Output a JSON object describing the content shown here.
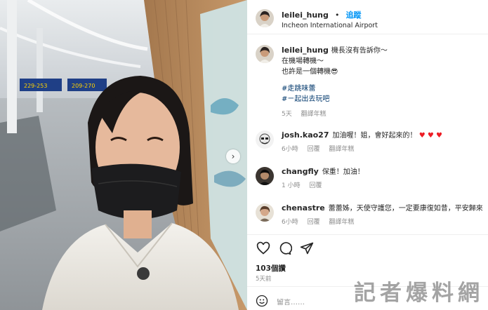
{
  "post": {
    "username": "leilei_hung",
    "separator": "•",
    "follow_label": "追蹤",
    "location": "Incheon International Airport"
  },
  "caption": {
    "username": "leilei_hung",
    "line1": "機長沒有告訴你～",
    "line2": "在機場轉機～",
    "line3": "也許是一個轉機",
    "emoji": "😎",
    "hashtag1": "#走跳味蕾",
    "hashtag2": "#ㄧ起出去玩吧",
    "time": "5天",
    "translate": "翻譯年糕"
  },
  "comments": [
    {
      "username": "josh.kao27",
      "text": "加油喔！姐，會好起來的！",
      "hearts": "♥ ♥ ♥",
      "time": "6小時",
      "reply": "回覆",
      "translate": "翻譯年糕"
    },
    {
      "username": "changfly",
      "text": "保重！加油！",
      "time": "1 小時",
      "reply": "回覆"
    },
    {
      "username": "chenastre",
      "text": "蕾蕾姊，天使守護您，一定要康復如昔，平安歸來",
      "time": "6小時",
      "reply": "回覆",
      "translate": "翻譯年糕"
    }
  ],
  "actions": {
    "icons": [
      "heart-icon",
      "comment-icon",
      "share-icon"
    ],
    "likes": "103個讚",
    "posted": "5天前"
  },
  "comment_input": {
    "placeholder": "留言……",
    "icon": "emoji-icon"
  },
  "photo": {
    "sign_text": "229-253",
    "sign_text2": "209-270"
  },
  "watermark": "記者爆料網",
  "colors": {
    "follow": "#0095f6",
    "hashtag": "#00376b",
    "heart": "#ed1c24",
    "muted": "#8e8e8e"
  }
}
